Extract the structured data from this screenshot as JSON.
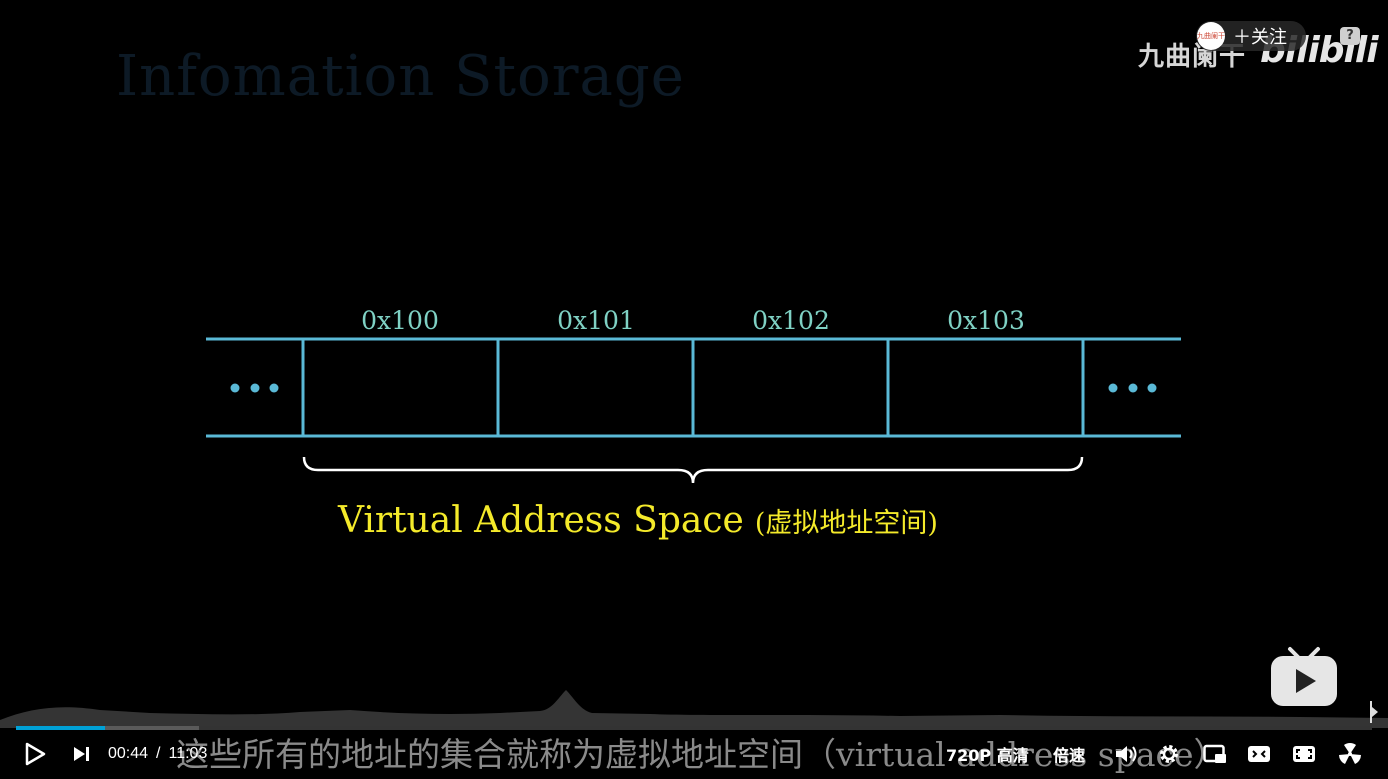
{
  "slide": {
    "title": "Infomation Storage",
    "addresses": [
      "0x100",
      "0x101",
      "0x102",
      "0x103"
    ],
    "ellipsis_left": "•••",
    "ellipsis_right": "•••",
    "label_en": "Virtual Address Space",
    "label_cn": "(虚拟地址空间)"
  },
  "overlay": {
    "channel_name": "九曲阑干",
    "logo_text": "bilibili",
    "avatar_text": "九曲阑干",
    "follow_label": "＋关注",
    "help_label": "?"
  },
  "player": {
    "subtitle": "这些所有的地址的集合就称为虚拟地址空间（virtual address space）",
    "current_time": "00:44",
    "time_sep": "/",
    "duration": "11:03",
    "progress_fraction": 0.066,
    "buffered_fraction": 0.135,
    "quality_label": "720P 高清",
    "speed_label": "倍速"
  },
  "colors": {
    "box_stroke": "#5ab9d6",
    "address_text": "#7fd1c4",
    "label_text": "#f4ea2a",
    "progress": "#00a1d6"
  },
  "icons": {
    "play": "play-icon",
    "next": "next-icon",
    "volume": "volume-icon",
    "settings": "gear-icon",
    "pip": "pip-icon",
    "widescreen": "widescreen-icon",
    "fullscreen_web": "web-fullscreen-icon",
    "fullscreen": "fullscreen-icon"
  }
}
